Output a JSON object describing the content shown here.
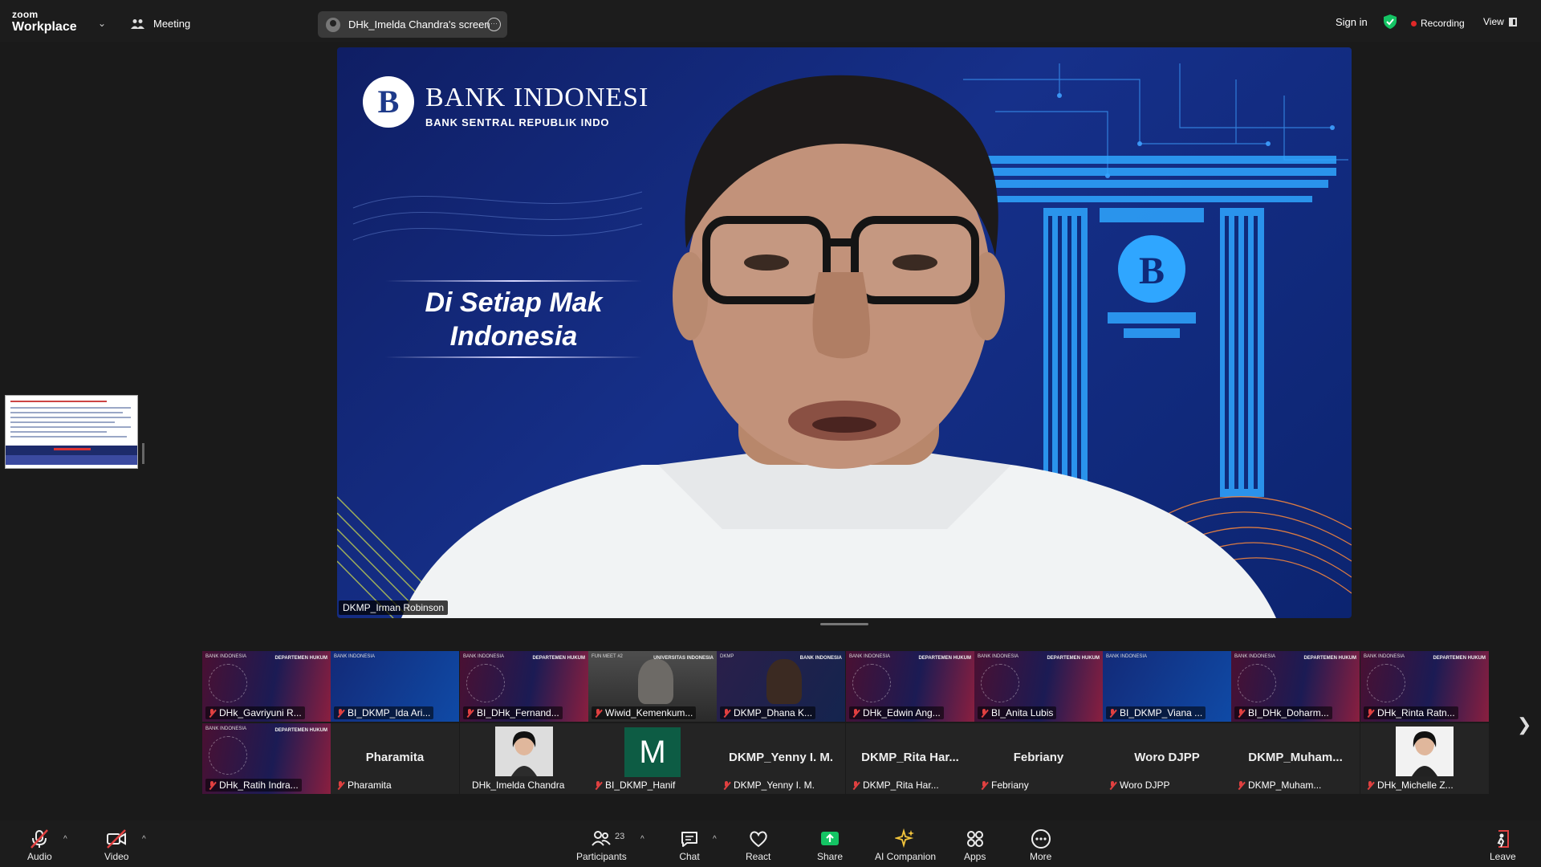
{
  "topbar": {
    "brand_top": "zoom",
    "brand_bottom": "Workplace",
    "meeting_label": "Meeting",
    "share_label": "DHk_Imelda Chandra's screen",
    "sign_in": "Sign in",
    "recording": "Recording",
    "view": "View"
  },
  "main_video": {
    "bank_name": "BANK INDONESI",
    "bank_subtitle": "BANK SENTRAL REPUBLIK INDO",
    "slogan_line1": "Di Setiap Mak",
    "slogan_line2": "Indonesia",
    "speaker_name": "DKMP_Irman Robinson"
  },
  "gallery": {
    "row1": [
      {
        "name": "DHk_Gavriyuni R...",
        "kind": "slide-red",
        "header_left": "BANK INDONESIA",
        "header_right": "DEPARTEMEN HUKUM"
      },
      {
        "name": "BI_DKMP_Ida Ari...",
        "kind": "slide-blue",
        "header_left": "BANK INDONESIA",
        "header_right": ""
      },
      {
        "name": "BI_DHk_Fernand...",
        "kind": "slide-red",
        "header_left": "BANK INDONESIA",
        "header_right": "DEPARTEMEN HUKUM"
      },
      {
        "name": "Wiwid_Kemenkum...",
        "kind": "photo",
        "header_left": "FUN MEET #2",
        "header_right": "UNIVERSITAS INDONESIA"
      },
      {
        "name": "DKMP_Dhana K...",
        "kind": "video-dark",
        "header_left": "DKMP",
        "header_right": "BANK INDONESIA"
      },
      {
        "name": "DHk_Edwin Ang...",
        "kind": "slide-red",
        "header_left": "BANK INDONESIA",
        "header_right": "DEPARTEMEN HUKUM"
      },
      {
        "name": "BI_Anita Lubis",
        "kind": "slide-red",
        "header_left": "BANK INDONESIA",
        "header_right": "DEPARTEMEN HUKUM"
      },
      {
        "name": "BI_DKMP_Viana ...",
        "kind": "slide-blue",
        "header_left": "BANK INDONESIA",
        "header_right": ""
      },
      {
        "name": "BI_DHk_Doharm...",
        "kind": "slide-red",
        "header_left": "BANK INDONESIA",
        "header_right": "DEPARTEMEN HUKUM"
      },
      {
        "name": "DHk_Rinta Ratn...",
        "kind": "slide-red",
        "header_left": "BANK INDONESIA",
        "header_right": "DEPARTEMEN HUKUM"
      }
    ],
    "row2": [
      {
        "name": "DHk_Ratih Indra...",
        "kind": "slide-red",
        "big": "",
        "header_left": "BANK INDONESIA",
        "header_right": "DEPARTEMEN HUKUM"
      },
      {
        "name": "Pharamita",
        "kind": "text",
        "big": "Pharamita"
      },
      {
        "name": "DHk_Imelda Chandra",
        "kind": "avatar-photo",
        "big": ""
      },
      {
        "name": "BI_DKMP_Hanif",
        "kind": "avatar-letter",
        "big": "M"
      },
      {
        "name": "DKMP_Yenny I. M.",
        "kind": "text",
        "big": "DKMP_Yenny I. M."
      },
      {
        "name": "DKMP_Rita Har...",
        "kind": "text",
        "big": "DKMP_Rita  Har..."
      },
      {
        "name": "Febriany",
        "kind": "text",
        "big": "Febriany"
      },
      {
        "name": "Woro DJPP",
        "kind": "text",
        "big": "Woro DJPP"
      },
      {
        "name": "DKMP_Muham...",
        "kind": "text",
        "big": "DKMP_Muham..."
      },
      {
        "name": "DHk_Michelle Z...",
        "kind": "avatar-white",
        "big": ""
      }
    ]
  },
  "toolbar": {
    "audio": "Audio",
    "video": "Video",
    "participants": "Participants",
    "participants_count": "23",
    "chat": "Chat",
    "react": "React",
    "share": "Share",
    "ai_companion": "AI Companion",
    "apps": "Apps",
    "more": "More",
    "leave": "Leave"
  },
  "colors": {
    "background": "#1a1a1a",
    "share_green": "#14c464",
    "record_red": "#e02828",
    "mute_red": "#e04040"
  }
}
